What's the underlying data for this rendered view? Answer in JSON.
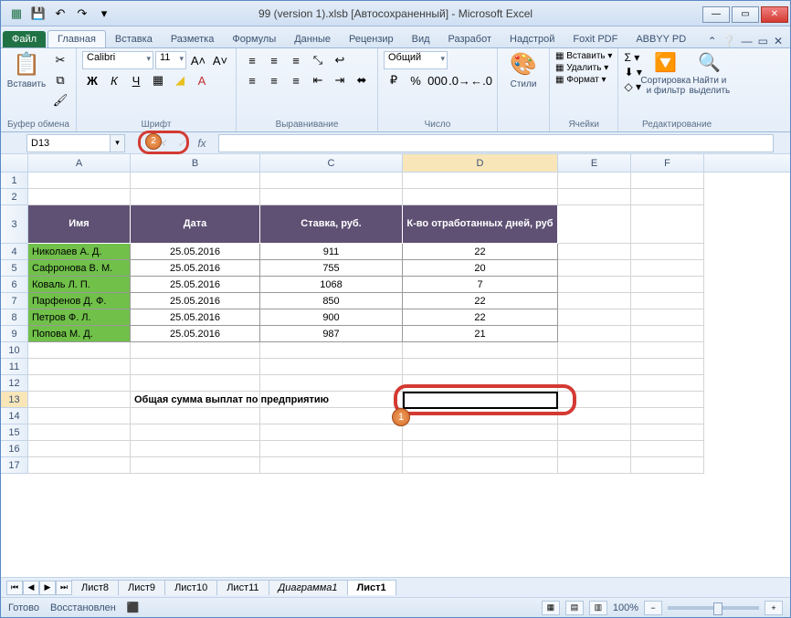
{
  "title": "99 (version 1).xlsb [Автосохраненный]  -  Microsoft Excel",
  "qat": {
    "excel": "⊞",
    "save": "💾",
    "undo": "↶",
    "redo": "↷"
  },
  "tabs": {
    "file": "Файл",
    "items": [
      "Главная",
      "Вставка",
      "Разметка",
      "Формулы",
      "Данные",
      "Рецензир",
      "Вид",
      "Разработ",
      "Надстрой",
      "Foxit PDF",
      "ABBYY PD"
    ],
    "active_index": 0
  },
  "ribbon": {
    "clipboard": {
      "paste": "Вставить",
      "label": "Буфер обмена"
    },
    "font": {
      "name": "Calibri",
      "size": "11",
      "label": "Шрифт"
    },
    "align": {
      "label": "Выравнивание"
    },
    "number": {
      "format": "Общий",
      "label": "Число"
    },
    "styles": {
      "btn": "Стили",
      "label": ""
    },
    "cells": {
      "insert": "Вставить",
      "delete": "Удалить",
      "format": "Формат",
      "label": "Ячейки"
    },
    "editing": {
      "sort": "Сортировка и фильтр",
      "find": "Найти и выделить",
      "label": "Редактирование"
    }
  },
  "namebox": "D13",
  "badges": {
    "fx": "2",
    "sel": "1"
  },
  "columns": [
    "A",
    "B",
    "C",
    "D",
    "E",
    "F"
  ],
  "table": {
    "headers": [
      "Имя",
      "Дата",
      "Ставка, руб.",
      "К-во отработанных дней, руб"
    ],
    "rows": [
      [
        "Николаев А. Д.",
        "25.05.2016",
        "911",
        "22"
      ],
      [
        "Сафронова В. М.",
        "25.05.2016",
        "755",
        "20"
      ],
      [
        "Коваль Л. П.",
        "25.05.2016",
        "1068",
        "7"
      ],
      [
        "Парфенов Д. Ф.",
        "25.05.2016",
        "850",
        "22"
      ],
      [
        "Петров Ф. Л.",
        "25.05.2016",
        "900",
        "22"
      ],
      [
        "Попова М. Д.",
        "25.05.2016",
        "987",
        "21"
      ]
    ]
  },
  "total_label": "Общая сумма выплат по предприятию",
  "sheets": {
    "items": [
      "Лист8",
      "Лист9",
      "Лист10",
      "Лист11",
      "Диаграмма1",
      "Лист1"
    ],
    "active_index": 5
  },
  "status": {
    "ready": "Готово",
    "recovered": "Восстановлен",
    "zoom": "100%"
  }
}
